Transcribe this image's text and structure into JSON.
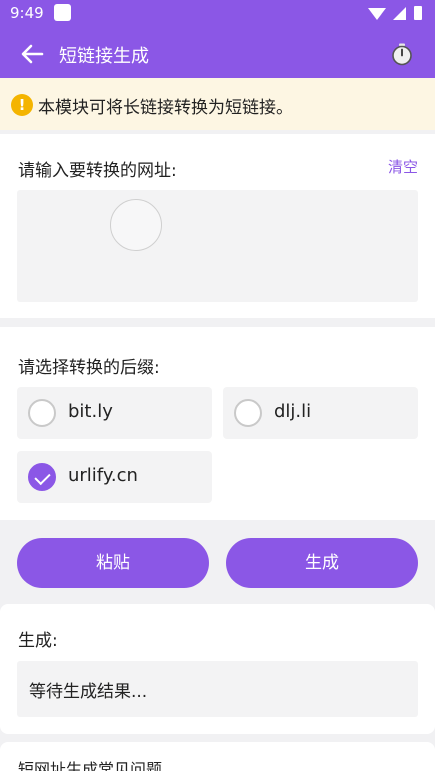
{
  "status_bar": {
    "time": "9:49"
  },
  "nav": {
    "title": "短链接生成"
  },
  "notice": {
    "icon_text": "!",
    "text": "本模块可将长链接转换为短链接。"
  },
  "url_section": {
    "label": "请输入要转换的网址:",
    "clear": "清空",
    "value": "",
    "placeholder": ""
  },
  "suffix_section": {
    "label": "请选择转换的后缀:",
    "options": [
      {
        "label": "bit.ly",
        "selected": false
      },
      {
        "label": "dlj.li",
        "selected": false
      },
      {
        "label": "urlify.cn",
        "selected": true
      }
    ]
  },
  "buttons": {
    "paste": "粘贴",
    "generate": "生成"
  },
  "result_section": {
    "label": "生成:",
    "value": "等待生成结果..."
  },
  "faq": {
    "title": "短网址生成常见问题"
  },
  "colors": {
    "accent": "#8b57e6",
    "notice_bg": "#fdf6e3",
    "warning": "#f4b400"
  }
}
